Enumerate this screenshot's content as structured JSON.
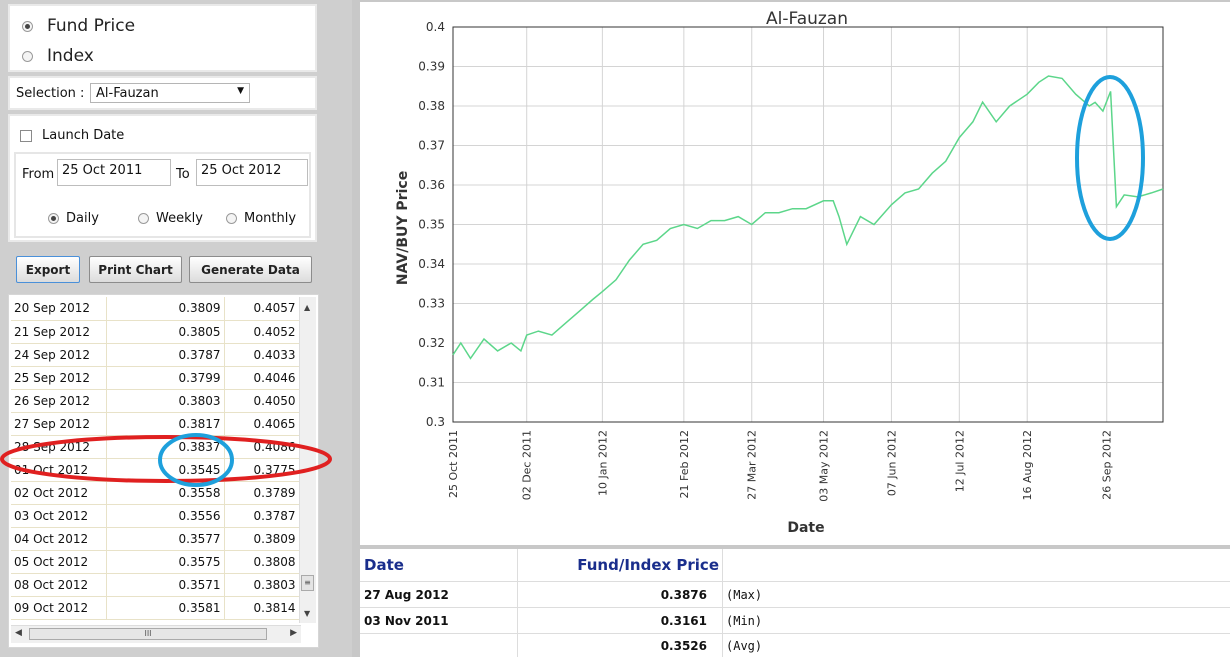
{
  "mode": {
    "fund_price_label": "Fund Price",
    "index_label": "Index",
    "selected": "fund_price"
  },
  "selection": {
    "label": "Selection :",
    "value": "Al-Fauzan"
  },
  "date_range": {
    "launch_date_label": "Launch Date",
    "from_label": "From",
    "from_value": "25 Oct 2011",
    "to_label": "To",
    "to_value": "25 Oct 2012",
    "frequency": [
      "Daily",
      "Weekly",
      "Monthly"
    ],
    "selected_frequency": "Daily"
  },
  "buttons": {
    "export": "Export",
    "print_chart": "Print Chart",
    "generate_data": "Generate Data"
  },
  "grid": {
    "rows": [
      [
        "20 Sep 2012",
        "0.3809",
        "0.4057"
      ],
      [
        "21 Sep 2012",
        "0.3805",
        "0.4052"
      ],
      [
        "24 Sep 2012",
        "0.3787",
        "0.4033"
      ],
      [
        "25 Sep 2012",
        "0.3799",
        "0.4046"
      ],
      [
        "26 Sep 2012",
        "0.3803",
        "0.4050"
      ],
      [
        "27 Sep 2012",
        "0.3817",
        "0.4065"
      ],
      [
        "28 Sep 2012",
        "0.3837",
        "0.4086"
      ],
      [
        "01 Oct 2012",
        "0.3545",
        "0.3775"
      ],
      [
        "02 Oct 2012",
        "0.3558",
        "0.3789"
      ],
      [
        "03 Oct 2012",
        "0.3556",
        "0.3787"
      ],
      [
        "04 Oct 2012",
        "0.3577",
        "0.3809"
      ],
      [
        "05 Oct 2012",
        "0.3575",
        "0.3808"
      ],
      [
        "08 Oct 2012",
        "0.3571",
        "0.3803"
      ],
      [
        "09 Oct 2012",
        "0.3581",
        "0.3814"
      ]
    ],
    "hscroll_grip": "III"
  },
  "chart_data": {
    "type": "line",
    "title": "Al-Fauzan",
    "xlabel": "Date",
    "ylabel": "NAV/BUY Price",
    "ylim": [
      0.3,
      0.4
    ],
    "yticks": [
      "0.3",
      "0.31",
      "0.32",
      "0.33",
      "0.34",
      "0.35",
      "0.36",
      "0.37",
      "0.38",
      "0.39",
      "0.4"
    ],
    "xticks": [
      "25 Oct 2011",
      "02 Dec 2011",
      "10 Jan 2012",
      "21 Feb 2012",
      "27 Mar 2012",
      "03 May 2012",
      "07 Jun 2012",
      "12 Jul 2012",
      "16 Aug 2012",
      "26 Sep 2012"
    ],
    "xlim": [
      "2011-10-25",
      "2012-10-25"
    ],
    "line_color": "#5cd68a",
    "grid": true,
    "series": [
      {
        "x": [
          "2011-10-25",
          "2011-10-29",
          "2011-11-03",
          "2011-11-10",
          "2011-11-17",
          "2011-11-24",
          "2011-11-29",
          "2011-12-02",
          "2011-12-08",
          "2011-12-15",
          "2011-12-22",
          "2011-12-29",
          "2012-01-05",
          "2012-01-10",
          "2012-01-17",
          "2012-01-24",
          "2012-01-31",
          "2012-02-07",
          "2012-02-14",
          "2012-02-21",
          "2012-02-28",
          "2012-03-06",
          "2012-03-13",
          "2012-03-20",
          "2012-03-27",
          "2012-04-03",
          "2012-04-10",
          "2012-04-17",
          "2012-04-24",
          "2012-05-03",
          "2012-05-08",
          "2012-05-11",
          "2012-05-15",
          "2012-05-22",
          "2012-05-29",
          "2012-06-07",
          "2012-06-14",
          "2012-06-21",
          "2012-06-28",
          "2012-07-05",
          "2012-07-12",
          "2012-07-19",
          "2012-07-24",
          "2012-07-31",
          "2012-08-07",
          "2012-08-16",
          "2012-08-22",
          "2012-08-27",
          "2012-09-03",
          "2012-09-10",
          "2012-09-17",
          "2012-09-20",
          "2012-09-24",
          "2012-09-28",
          "2012-10-01",
          "2012-10-05",
          "2012-10-12",
          "2012-10-19",
          "2012-10-25"
        ],
        "y": [
          0.317,
          0.32,
          0.3161,
          0.321,
          0.318,
          0.32,
          0.318,
          0.322,
          0.323,
          0.322,
          0.325,
          0.328,
          0.331,
          0.333,
          0.336,
          0.341,
          0.345,
          0.346,
          0.349,
          0.35,
          0.349,
          0.351,
          0.351,
          0.352,
          0.35,
          0.353,
          0.353,
          0.354,
          0.354,
          0.356,
          0.356,
          0.352,
          0.345,
          0.352,
          0.35,
          0.355,
          0.358,
          0.359,
          0.363,
          0.366,
          0.372,
          0.376,
          0.381,
          0.376,
          0.38,
          0.383,
          0.386,
          0.3876,
          0.387,
          0.383,
          0.38,
          0.3809,
          0.3787,
          0.3837,
          0.3545,
          0.3575,
          0.357,
          0.358,
          0.359
        ]
      }
    ]
  },
  "stats": {
    "date_header": "Date",
    "price_header": "Fund/Index Price",
    "rows": [
      {
        "date": "27 Aug 2012",
        "value": "0.3876",
        "tag": "(Max)"
      },
      {
        "date": "03 Nov 2011",
        "value": "0.3161",
        "tag": "(Min)"
      },
      {
        "date": "",
        "value": "0.3526",
        "tag": "(Avg)"
      }
    ]
  },
  "annotation_colors": {
    "red": "#e02020",
    "blue": "#1ea0dc"
  }
}
